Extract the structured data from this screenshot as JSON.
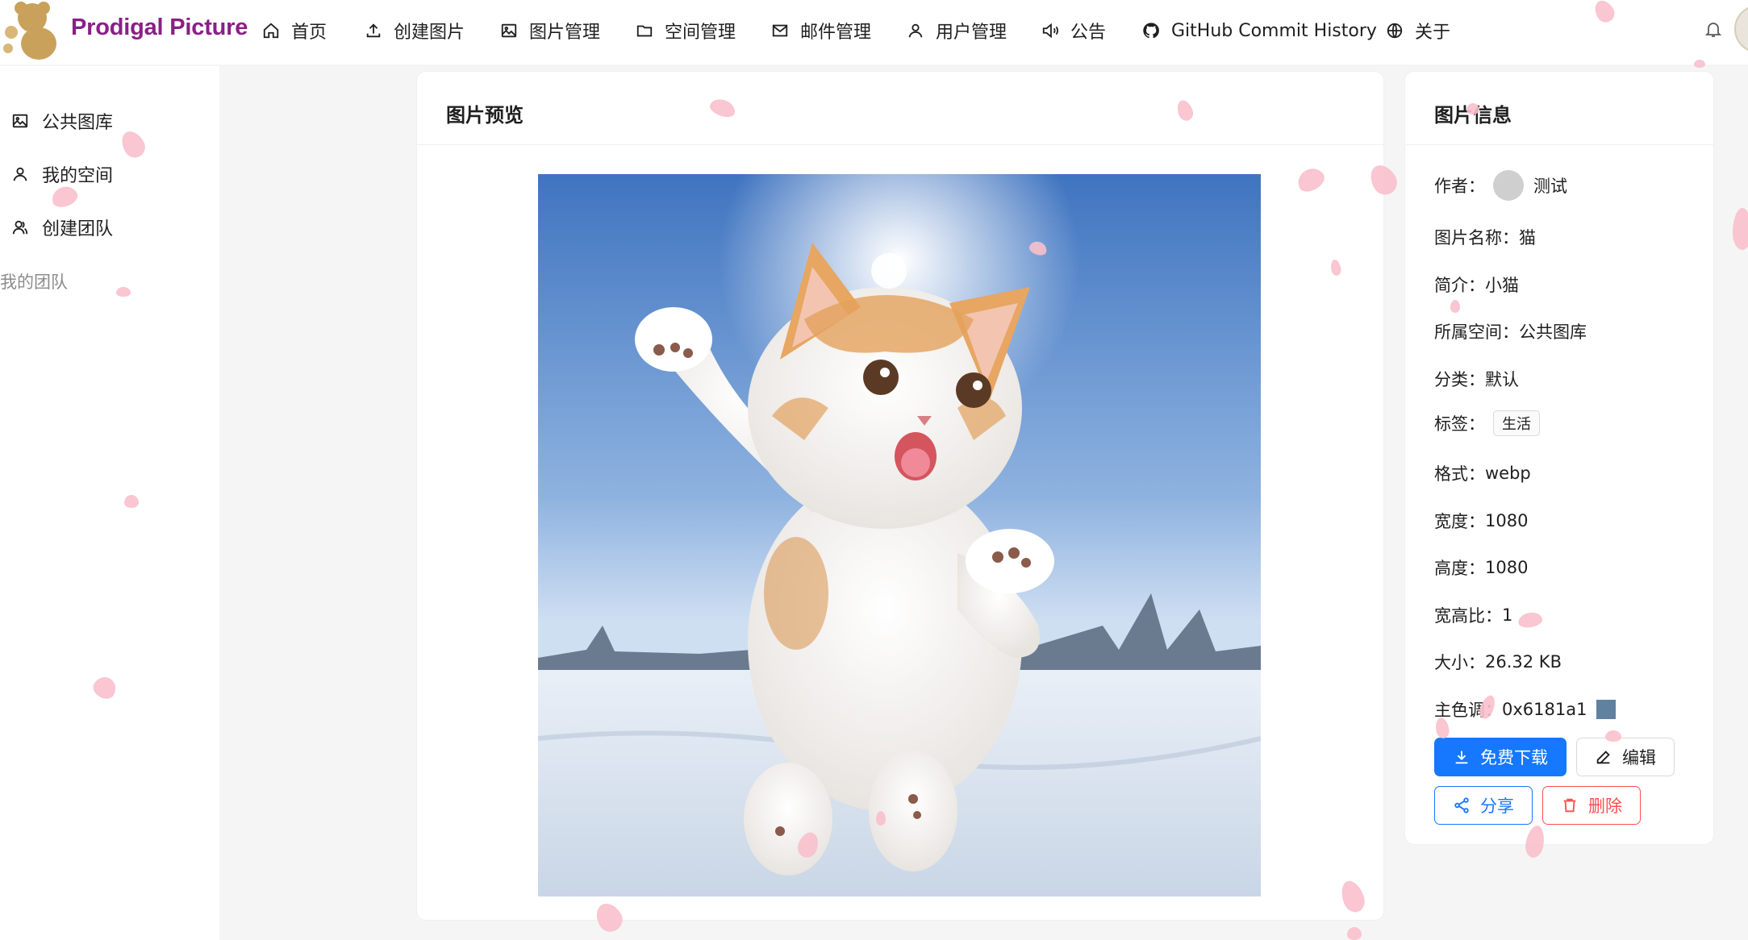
{
  "header": {
    "brand": "Prodigal Picture",
    "nav": [
      {
        "label": "首页",
        "icon": "home-icon"
      },
      {
        "label": "创建图片",
        "icon": "upload-icon"
      },
      {
        "label": "图片管理",
        "icon": "picture-icon"
      },
      {
        "label": "空间管理",
        "icon": "folder-icon"
      },
      {
        "label": "邮件管理",
        "icon": "mail-icon"
      },
      {
        "label": "用户管理",
        "icon": "user-icon"
      },
      {
        "label": "公告",
        "icon": "sound-icon"
      },
      {
        "label": "GitHub Commit History",
        "icon": "github-icon"
      },
      {
        "label": "关于",
        "icon": "global-icon"
      }
    ]
  },
  "sidebar": {
    "items": [
      {
        "label": "公共图库",
        "icon": "picture-icon"
      },
      {
        "label": "我的空间",
        "icon": "user-icon"
      },
      {
        "label": "创建团队",
        "icon": "team-icon"
      }
    ],
    "group_title": "我的团队"
  },
  "preview": {
    "title": "图片预览",
    "image_alt": "猫"
  },
  "info": {
    "title": "图片信息",
    "author_label": "作者：",
    "author_name": "测试",
    "name_label": "图片名称：",
    "name_value": "猫",
    "intro_label": "简介：",
    "intro_value": "小猫",
    "space_label": "所属空间：",
    "space_value": "公共图库",
    "category_label": "分类：",
    "category_value": "默认",
    "tags_label": "标签：",
    "tags": [
      "生活"
    ],
    "format_label": "格式：",
    "format_value": "webp",
    "width_label": "宽度：",
    "width_value": "1080",
    "height_label": "高度：",
    "height_value": "1080",
    "ratio_label": "宽高比：",
    "ratio_value": "1",
    "size_label": "大小：",
    "size_value": "26.32 KB",
    "color_label": "主色调：",
    "color_value": "0x6181a1",
    "color_hex": "#6181a1"
  },
  "actions": {
    "download": "免费下载",
    "edit": "编辑",
    "share": "分享",
    "delete": "删除"
  },
  "colors": {
    "brand": "#8a1f86",
    "primary": "#1677ff",
    "danger": "#ff4d4f"
  }
}
